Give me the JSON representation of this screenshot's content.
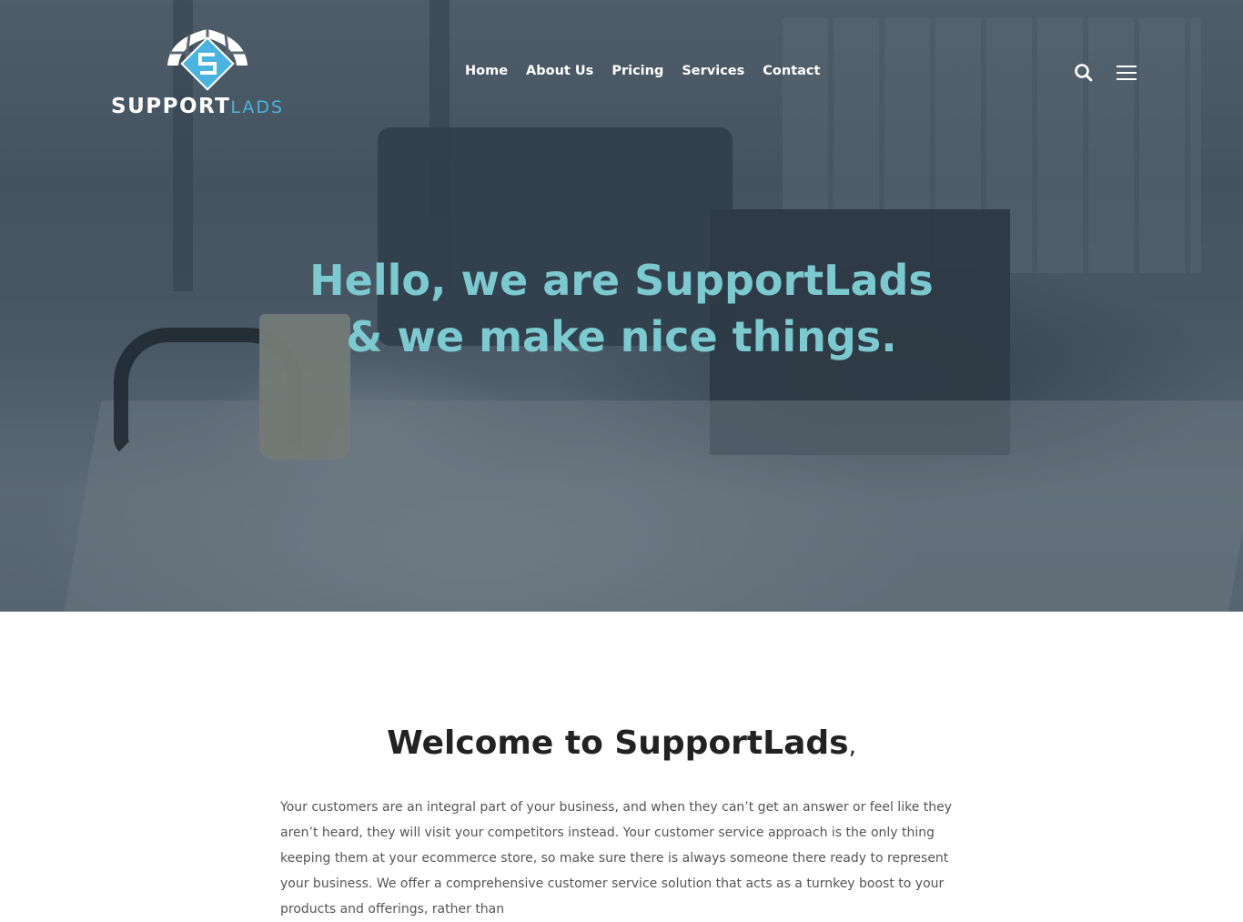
{
  "brand": {
    "name_primary": "SUPPORT",
    "name_secondary": "LADS",
    "logo_icon": "shield-s-logo",
    "primary_color": "#4ab3e0",
    "accent_color": "#7cc9cf"
  },
  "nav": {
    "items": [
      {
        "label": "Home"
      },
      {
        "label": "About Us"
      },
      {
        "label": "Pricing"
      },
      {
        "label": "Services"
      },
      {
        "label": "Contact"
      }
    ],
    "search_icon": "search-icon",
    "menu_icon": "hamburger-menu-icon"
  },
  "hero": {
    "line1": "Hello, we are SupportLads",
    "line2": "& we make nice things."
  },
  "welcome": {
    "title": "Welcome to SupportLads",
    "punct": ",",
    "paragraph": "Your customers are an integral part of your business, and when they can’t get an answer or feel like they aren’t heard, they will visit your competitors instead. Your customer service approach is the only thing keeping them at your ecommerce store, so make sure there is always someone there ready to represent your business. We offer a comprehensive customer service solution that acts as a turnkey boost to your products and offerings, rather than"
  }
}
